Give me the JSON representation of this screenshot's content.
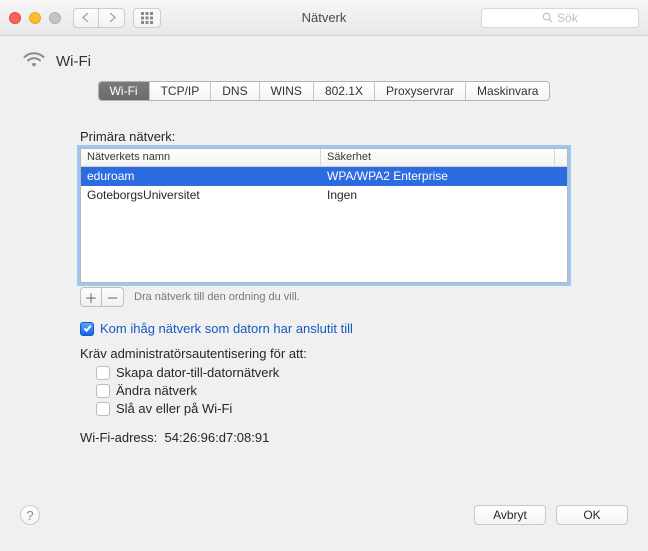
{
  "window": {
    "title": "Nätverk",
    "search_placeholder": "Sök"
  },
  "header": {
    "title": "Wi-Fi"
  },
  "tabs": [
    {
      "label": "Wi-Fi",
      "active": true
    },
    {
      "label": "TCP/IP",
      "active": false
    },
    {
      "label": "DNS",
      "active": false
    },
    {
      "label": "WINS",
      "active": false
    },
    {
      "label": "802.1X",
      "active": false
    },
    {
      "label": "Proxyservrar",
      "active": false
    },
    {
      "label": "Maskinvara",
      "active": false
    }
  ],
  "primary_label": "Primära nätverk:",
  "table": {
    "columns": {
      "name": "Nätverkets namn",
      "security": "Säkerhet"
    },
    "rows": [
      {
        "name": "eduroam",
        "security": "WPA/WPA2 Enterprise",
        "selected": true
      },
      {
        "name": "GoteborgsUniversitet",
        "security": "Ingen",
        "selected": false
      }
    ]
  },
  "drag_hint": "Dra nätverk till den ordning du vill.",
  "remember_label": "Kom ihåg nätverk som datorn har anslutit till",
  "admin_label": "Kräv administratörsautentisering för att:",
  "admin_options": {
    "create": "Skapa dator-till-datornätverk",
    "change": "Ändra nätverk",
    "toggle": "Slå av eller på Wi-Fi"
  },
  "wifi_address": {
    "label": "Wi-Fi-adress:",
    "value": "54:26:96:d7:08:91"
  },
  "buttons": {
    "cancel": "Avbryt",
    "ok": "OK",
    "add": "＋",
    "remove": "－",
    "help": "?"
  }
}
